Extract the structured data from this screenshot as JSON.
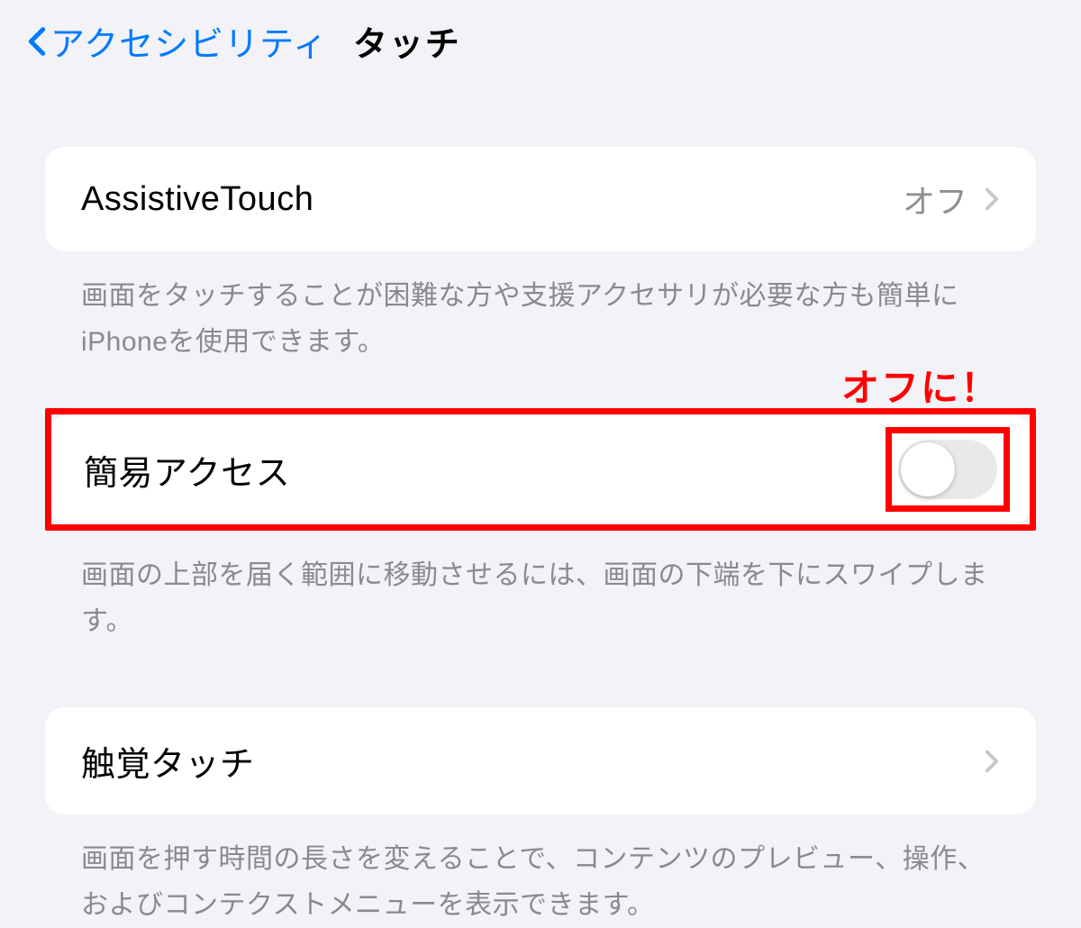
{
  "header": {
    "back_label": "アクセシビリティ",
    "title": "タッチ"
  },
  "groups": [
    {
      "row": {
        "title": "AssistiveTouch",
        "value": "オフ"
      },
      "footer": "画面をタッチすることが困難な方や支援アクセサリが必要な方も簡単にiPhoneを使用できます。"
    },
    {
      "annotation": "オフに！",
      "row": {
        "title": "簡易アクセス"
      },
      "footer": "画面の上部を届く範囲に移動させるには、画面の下端を下にスワイプします。"
    },
    {
      "row": {
        "title": "触覚タッチ"
      },
      "footer": "画面を押す時間の長さを変えることで、コンテンツのプレビュー、操作、およびコンテクストメニューを表示できます。"
    }
  ],
  "colors": {
    "accent": "#007aff",
    "highlight": "#ff0000",
    "background": "#f2f2f7",
    "card": "#ffffff",
    "secondary_text": "#8a8a8e"
  }
}
